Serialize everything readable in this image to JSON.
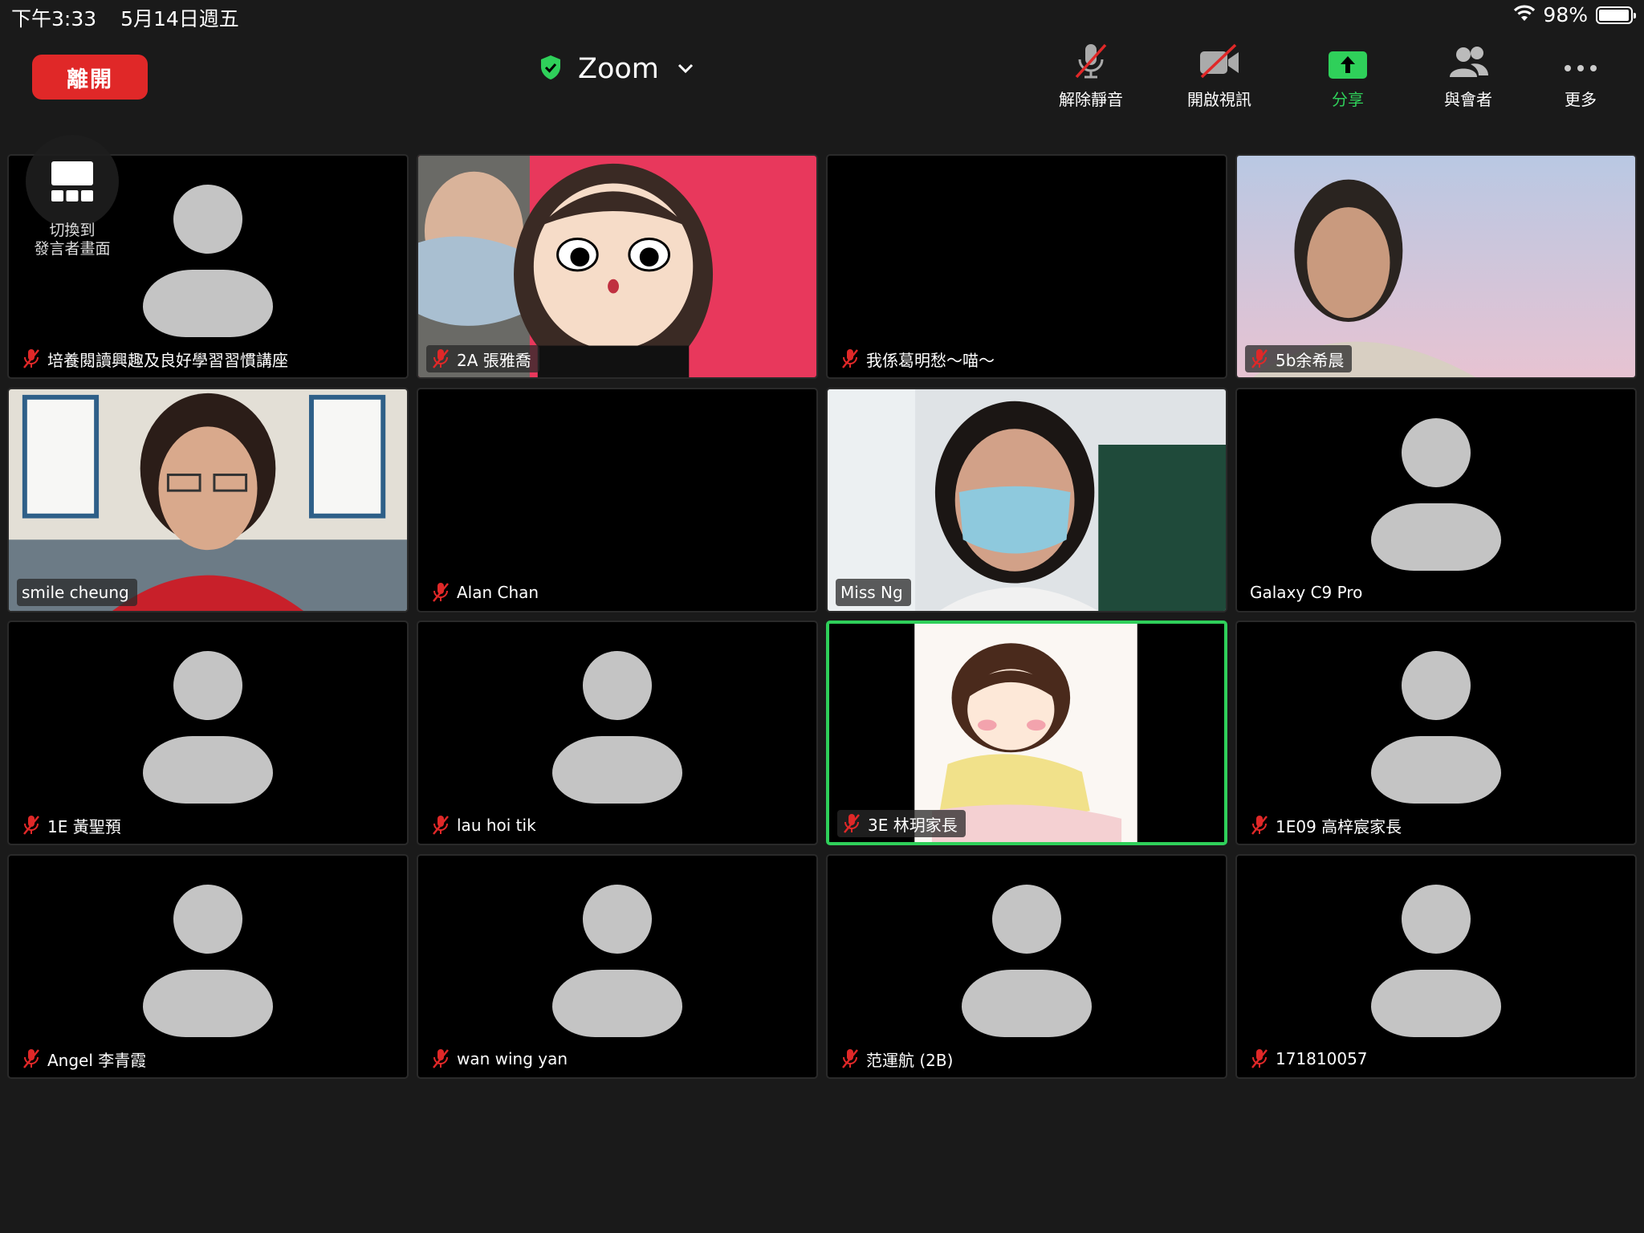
{
  "status_bar": {
    "time": "下午3:33",
    "date": "5月14日週五",
    "battery": "98%",
    "battery_level": 0.98
  },
  "header": {
    "leave_label": "離開",
    "meeting_title": "Zoom",
    "toolbar": {
      "unmute": "解除靜音",
      "start_video": "開啟視訊",
      "share": "分享",
      "participants": "與會者",
      "more": "更多"
    },
    "share_color": "#2fd05a",
    "leave_color": "#e02828"
  },
  "switch_view": {
    "label_line1": "切換到",
    "label_line2": "發言者畫面"
  },
  "participants": [
    {
      "name": "培養閱讀興趣及良好學習習慣講座",
      "muted": true,
      "video": "avatar"
    },
    {
      "name": "2A 張雅喬",
      "muted": true,
      "video": "cartoon-girl-with-man"
    },
    {
      "name": "我係葛明愁～喵～",
      "muted": true,
      "video": "black"
    },
    {
      "name": "5b余希晨",
      "muted": true,
      "video": "woman-sky"
    },
    {
      "name": "smile cheung",
      "muted": false,
      "video": "woman-room"
    },
    {
      "name": "Alan Chan",
      "muted": true,
      "video": "black"
    },
    {
      "name": "Miss Ng",
      "muted": false,
      "video": "woman-mask-classroom"
    },
    {
      "name": "Galaxy C9 Pro",
      "muted": false,
      "video": "avatar"
    },
    {
      "name": "1E 黃聖預",
      "muted": true,
      "video": "avatar"
    },
    {
      "name": "lau hoi tik",
      "muted": true,
      "video": "avatar"
    },
    {
      "name": "3E 林玥家長",
      "muted": true,
      "video": "cartoon-girl-drawing",
      "active_speaker": true
    },
    {
      "name": "1E09 高梓宸家長",
      "muted": true,
      "video": "avatar"
    },
    {
      "name": "Angel 李青霞",
      "muted": true,
      "video": "avatar"
    },
    {
      "name": "wan wing yan",
      "muted": true,
      "video": "avatar"
    },
    {
      "name": "范運航 (2B)",
      "muted": true,
      "video": "avatar"
    },
    {
      "name": "171810057",
      "muted": true,
      "video": "avatar"
    }
  ]
}
